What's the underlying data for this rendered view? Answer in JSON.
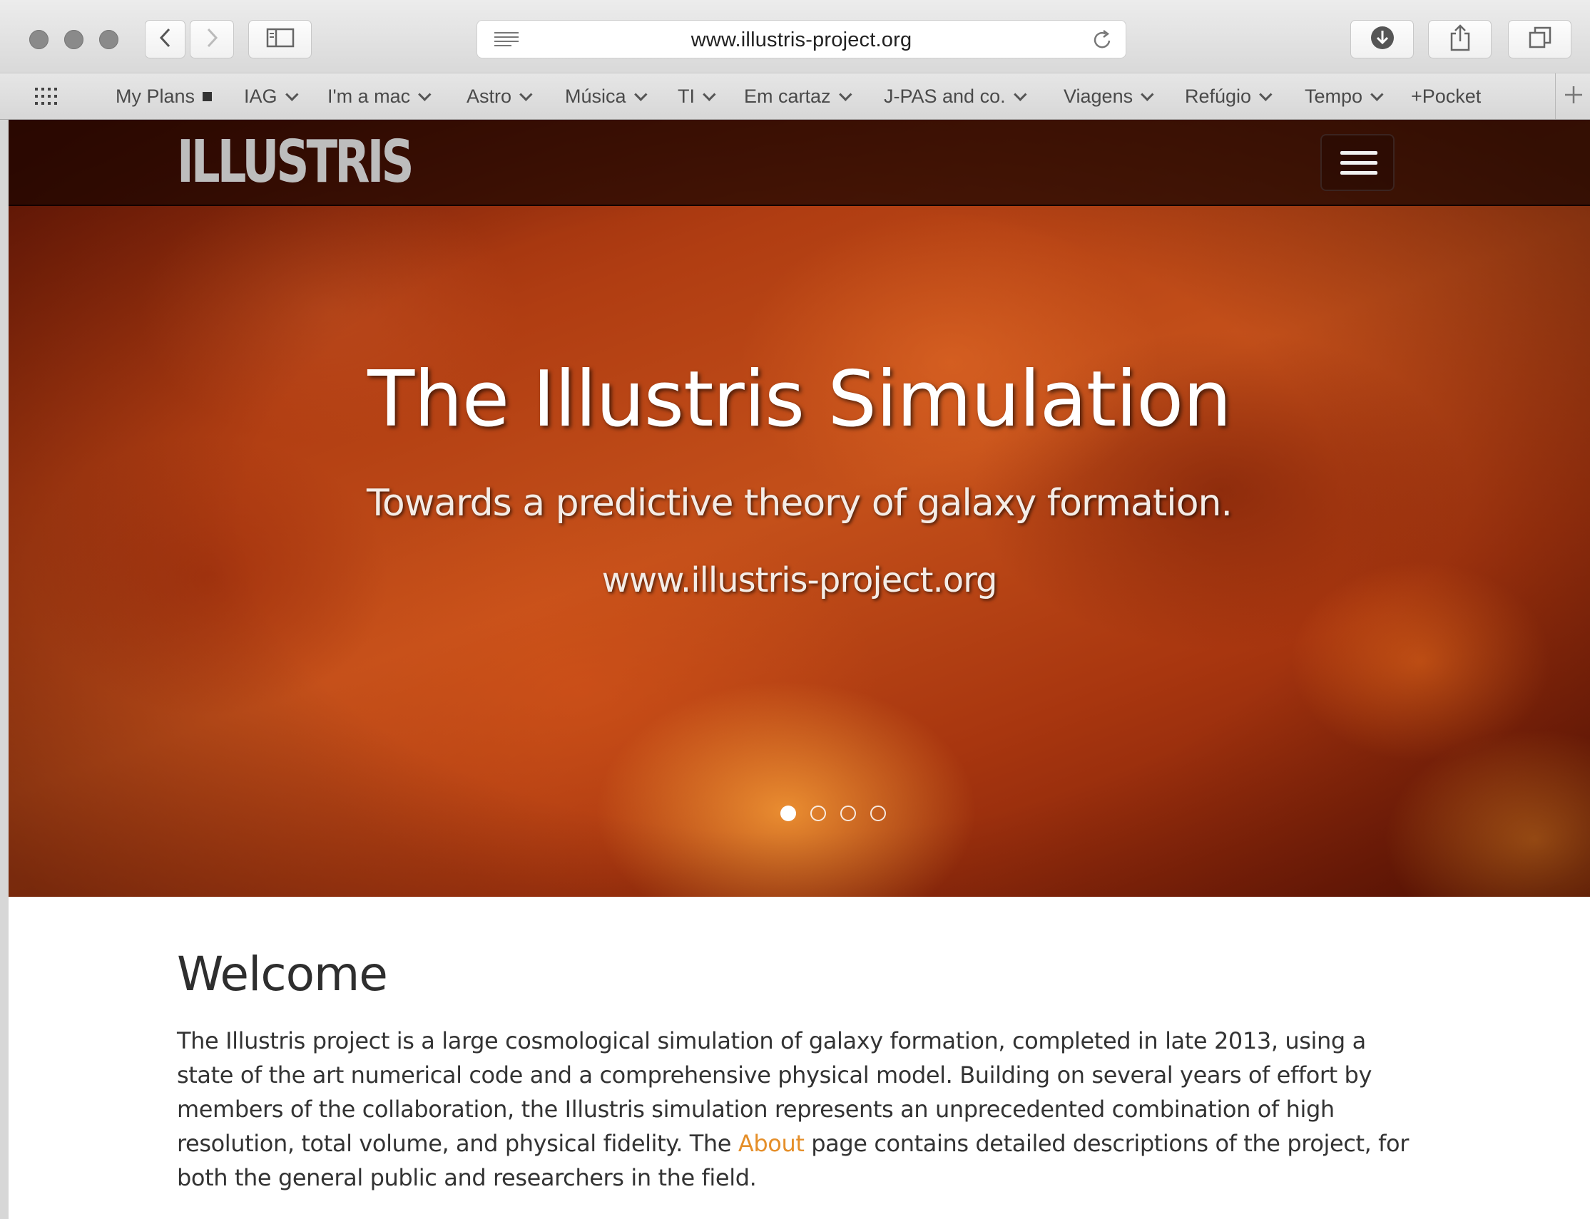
{
  "browser": {
    "url": "www.illustris-project.org",
    "bookmarks": [
      {
        "label": "My Plans",
        "marker": "square"
      },
      {
        "label": "IAG",
        "marker": "chevron"
      },
      {
        "label": "I'm a mac",
        "marker": "chevron"
      },
      {
        "label": "Astro",
        "marker": "chevron"
      },
      {
        "label": "Música",
        "marker": "chevron"
      },
      {
        "label": "TI",
        "marker": "chevron"
      },
      {
        "label": "Em cartaz",
        "marker": "chevron"
      },
      {
        "label": "J-PAS and co.",
        "marker": "chevron"
      },
      {
        "label": "Viagens",
        "marker": "chevron"
      },
      {
        "label": "Refúgio",
        "marker": "chevron"
      },
      {
        "label": "Tempo",
        "marker": "chevron"
      },
      {
        "label": "+Pocket",
        "marker": "none"
      }
    ],
    "icons": [
      "back-icon",
      "forward-icon",
      "sidebar-icon",
      "reader-icon",
      "reload-icon",
      "download-icon",
      "share-icon",
      "tabs-icon",
      "apps-grid-icon",
      "add-icon"
    ]
  },
  "site": {
    "logo": "ILLUSTRIS",
    "hero": {
      "title": "The Illustris Simulation",
      "subtitle": "Towards a predictive theory of galaxy formation.",
      "url": "www.illustris-project.org",
      "slides_total": 4,
      "active_slide": 1
    },
    "welcome": {
      "title": "Welcome",
      "text_before_link": "The Illustris project is a large cosmological simulation of galaxy formation, completed in late 2013, using a state of the art numerical code and a comprehensive physical model. Building on several years of effort by members of the collaboration, the Illustris simulation represents an unprecedented combination of high resolution, total volume, and physical fidelity. The ",
      "link_text": "About",
      "text_after_link": " page contains detailed descriptions of the project, for both the general public and researchers in the field."
    }
  },
  "colors": {
    "link": "#e58f2a",
    "hero_base": "#b03d12",
    "navbar": "#190400"
  }
}
